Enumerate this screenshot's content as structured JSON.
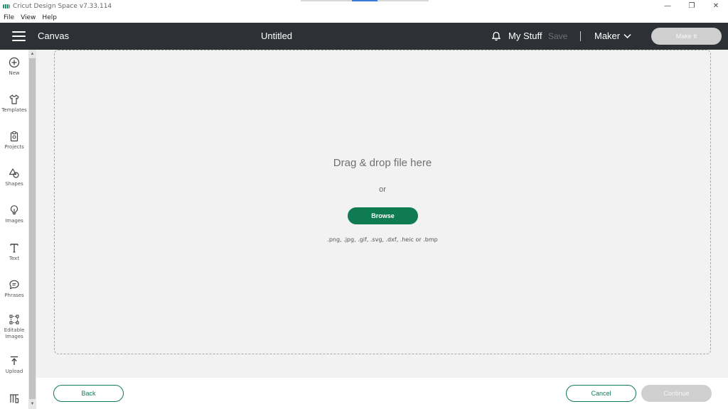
{
  "window": {
    "title": "Cricut Design Space  v7.33.114",
    "controls": [
      "—",
      "❐",
      "✕"
    ]
  },
  "menu": [
    "File",
    "View",
    "Help"
  ],
  "header": {
    "section": "Canvas",
    "title": "Untitled",
    "my_stuff": "My Stuff",
    "save": "Save",
    "machine": "Maker",
    "make_it": "Make It"
  },
  "sidebar": [
    {
      "label": "New",
      "icon": "plus-circle-icon"
    },
    {
      "label": "Templates",
      "icon": "shirt-icon"
    },
    {
      "label": "Projects",
      "icon": "clipboard-icon"
    },
    {
      "label": "Shapes",
      "icon": "shapes-icon"
    },
    {
      "label": "Images",
      "icon": "lightbulb-icon"
    },
    {
      "label": "Text",
      "icon": "text-t-icon"
    },
    {
      "label": "Phrases",
      "icon": "speech-bubble-icon"
    },
    {
      "label": "Editable\nImages",
      "icon": "editable-images-icon"
    },
    {
      "label": "Upload",
      "icon": "upload-icon"
    }
  ],
  "upload": {
    "drag_text": "Drag & drop file here",
    "or_text": "or",
    "browse": "Browse",
    "file_types": ".png, .jpg, .gif, .svg, .dxf, .heic or .bmp"
  },
  "footer": {
    "back": "Back",
    "cancel": "Cancel",
    "continue": "Continue"
  },
  "colors": {
    "header_bg": "#2d3035",
    "accent_green": "#0f7b52",
    "disabled_bg": "#cfcfcf",
    "canvas_bg": "#f2f2f2"
  }
}
